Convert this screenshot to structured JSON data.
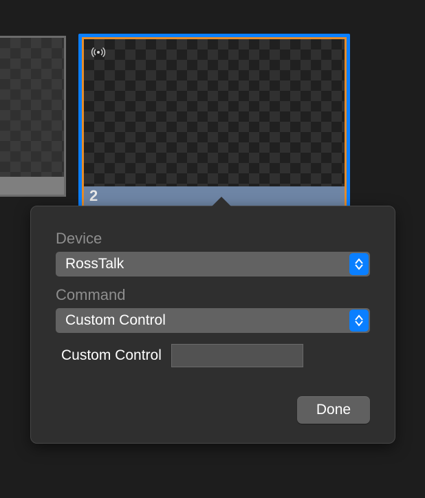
{
  "thumbnails": {
    "selected_index": 2,
    "selected_label": "2",
    "broadcast_icon": "broadcast-icon"
  },
  "popover": {
    "device_label": "Device",
    "device_value": "RossTalk",
    "command_label": "Command",
    "command_value": "Custom Control",
    "custom_control_label": "Custom Control",
    "custom_control_value": "",
    "done_label": "Done"
  }
}
